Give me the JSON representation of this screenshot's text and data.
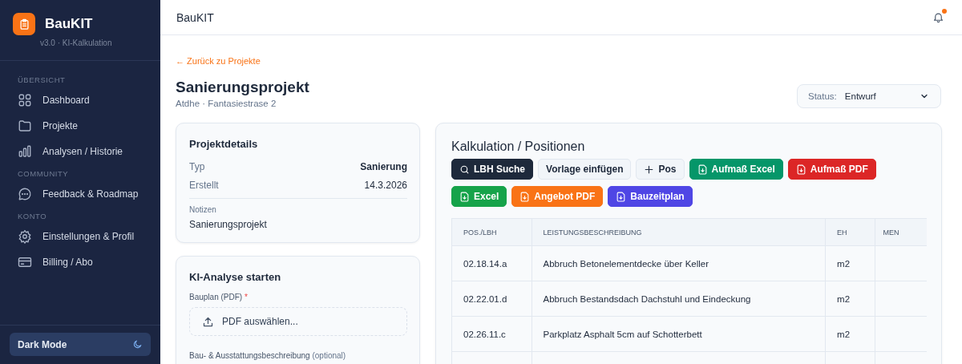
{
  "sidebar": {
    "brand": {
      "name": "BauKIT",
      "subtitle": "v3.0 · KI-Kalkulation"
    },
    "sections": [
      {
        "title": "ÜBERSICHT",
        "items": [
          {
            "label": "Dashboard",
            "kind": "grid",
            "selected": false
          },
          {
            "label": "Projekte",
            "kind": "folder",
            "selected": false
          },
          {
            "label": "Analysen / Historie",
            "kind": "bars",
            "selected": false
          }
        ]
      },
      {
        "title": "COMMUNITY",
        "items": [
          {
            "label": "Feedback & Roadmap",
            "kind": "chat",
            "selected": false
          }
        ]
      },
      {
        "title": "KONTO",
        "items": [
          {
            "label": "Einstellungen & Profil",
            "kind": "gear",
            "selected": false
          },
          {
            "label": "Billing / Abo",
            "kind": "card",
            "selected": false
          }
        ]
      }
    ],
    "dark_mode": {
      "label": "Dark Mode",
      "on": false
    }
  },
  "header": {
    "title": "BauKIT",
    "has_notification": true
  },
  "page": {
    "back_link": "← Zurück zu Projekte",
    "title": "Sanierungsprojekt",
    "subtitle": "Atdhe · Fantasiestrase 2",
    "status": {
      "label": "Status:",
      "value": "Entwurf"
    }
  },
  "details": {
    "title": "Projektdetails",
    "rows": [
      {
        "label": "Typ",
        "value": "Sanierung",
        "emphasis": true
      },
      {
        "label": "Erstellt",
        "value": "14.3.2026",
        "emphasis": false
      }
    ],
    "notes_label": "Notizen",
    "notes": "Sanierungsprojekt"
  },
  "analysis": {
    "title": "KI-Analyse starten",
    "fields": [
      {
        "label": "Bauplan (PDF)",
        "required_mark": "*",
        "button": "PDF auswählen..."
      },
      {
        "label": "Bau- & Ausstattungsbeschreibung",
        "hint": "(optional)"
      }
    ]
  },
  "calculation": {
    "title": "Kalkulation / Positionen",
    "buttons": [
      {
        "label": "LBH Suche",
        "kind": "search",
        "color": "#1e293b"
      },
      {
        "label": "Vorlage einfügen",
        "kind": "plain",
        "color": "#f1f5f9"
      },
      {
        "label": "Pos",
        "kind": "add",
        "color": "#f1f5f9"
      },
      {
        "label": "Aufmaß Excel",
        "kind": "export",
        "color": "#059669"
      },
      {
        "label": "Aufmaß PDF",
        "kind": "export",
        "color": "#dc2626"
      },
      {
        "label": "Excel",
        "kind": "export",
        "color": "#16a34a"
      },
      {
        "label": "Angebot PDF",
        "kind": "export",
        "color": "#f97316"
      },
      {
        "label": "Bauzeitplan",
        "kind": "export",
        "color": "#4f46e5"
      }
    ],
    "table": {
      "columns": [
        "POS./LBH",
        "LEISTUNGSBESCHREIBUNG",
        "EH",
        "MEN"
      ],
      "rows": [
        [
          "02.18.14.a",
          "Abbruch Betonelementdecke über Keller",
          "m2"
        ],
        [
          "02.22.01.d",
          "Abbruch Bestandsdach Dachstuhl und Eindeckung",
          "m2"
        ],
        [
          "02.26.11.c",
          "Parkplatz Asphalt 5cm auf Schotterbett",
          "m2"
        ]
      ]
    }
  }
}
